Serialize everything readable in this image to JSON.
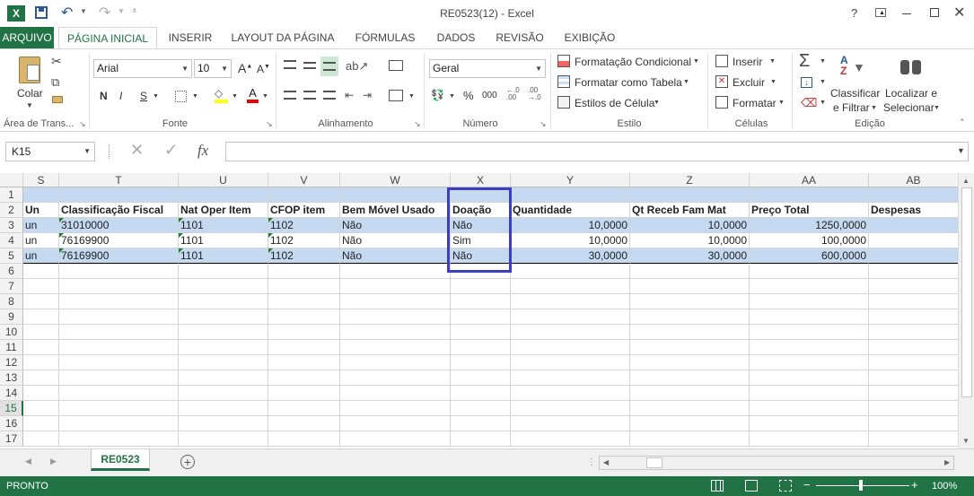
{
  "window": {
    "title": "RE0523(12) - Excel",
    "help_glyph": "?"
  },
  "tabs": [
    "ARQUIVO",
    "PÁGINA INICIAL",
    "INSERIR",
    "LAYOUT DA PÁGINA",
    "FÓRMULAS",
    "DADOS",
    "REVISÃO",
    "EXIBIÇÃO"
  ],
  "ribbon": {
    "clipboard": {
      "paste_label": "Colar",
      "group_label": "Área de Trans..."
    },
    "font": {
      "font_name": "Arial",
      "font_size": "10",
      "bold": "N",
      "italic": "I",
      "underline": "S",
      "group_label": "Fonte"
    },
    "alignment": {
      "group_label": "Alinhamento"
    },
    "number": {
      "format": "Geral",
      "percent": "%",
      "thousands": "000",
      "group_label": "Número"
    },
    "styles": {
      "cond_format": "Formatação Condicional",
      "as_table": "Formatar como Tabela",
      "cell_styles": "Estilos de Célula",
      "group_label": "Estilo"
    },
    "cells": {
      "insert": "Inserir",
      "delete": "Excluir",
      "format": "Formatar",
      "group_label": "Células"
    },
    "editing": {
      "sort_l1": "Classificar",
      "sort_l2": "e Filtrar",
      "find_l1": "Localizar e",
      "find_l2": "Selecionar",
      "group_label": "Edição"
    }
  },
  "formula_bar": {
    "name_box": "K15",
    "fx": "fx",
    "value": ""
  },
  "columns": [
    "S",
    "T",
    "U",
    "V",
    "W",
    "X",
    "Y",
    "Z",
    "AA",
    "AB"
  ],
  "rows": [
    "1",
    "2",
    "3",
    "4",
    "5",
    "6",
    "7",
    "8",
    "9",
    "10",
    "11",
    "12",
    "13",
    "14",
    "15",
    "16",
    "17"
  ],
  "selected_row": "15",
  "table": {
    "headers": [
      "Un",
      "Classificação Fiscal",
      "Nat Oper Item",
      "CFOP item",
      "Bem Móvel Usado",
      "Doação",
      "Quantidade",
      "Qt Receb Fam Mat",
      "Preço Total",
      "Despesas"
    ],
    "rows": [
      [
        "un",
        "31010000",
        "1101",
        "1102",
        "Não",
        "Não",
        "10,0000",
        "10,0000",
        "1250,0000",
        ""
      ],
      [
        "un",
        "76169900",
        "1101",
        "1102",
        "Não",
        "Sim",
        "10,0000",
        "10,0000",
        "100,0000",
        ""
      ],
      [
        "un",
        "76169900",
        "1101",
        "1102",
        "Não",
        "Não",
        "30,0000",
        "30,0000",
        "600,0000",
        ""
      ]
    ]
  },
  "highlight_color": "#3b3fbf",
  "band_color": "#c5d9f1",
  "accent_color": "#217346",
  "sheet_tab": "RE0523",
  "status": {
    "ready": "PRONTO",
    "zoom": "100%"
  }
}
